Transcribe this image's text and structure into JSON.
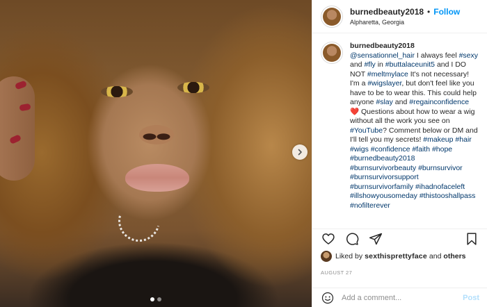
{
  "header": {
    "username": "burnedbeauty2018",
    "separator": "•",
    "follow_label": "Follow",
    "location": "Alpharetta, Georgia"
  },
  "caption": {
    "username": "burnedbeauty2018",
    "segments": [
      {
        "t": "@sensationnel_hair",
        "tag": true
      },
      {
        "t": " I always feel ",
        "tag": false
      },
      {
        "t": "#sexy",
        "tag": true
      },
      {
        "t": " and ",
        "tag": false
      },
      {
        "t": "#fly",
        "tag": true
      },
      {
        "t": " in ",
        "tag": false
      },
      {
        "t": "#buttalaceunit5",
        "tag": true
      },
      {
        "t": " and I DO NOT ",
        "tag": false
      },
      {
        "t": "#meltmylace",
        "tag": true
      },
      {
        "t": " It's not necessary! I'm a ",
        "tag": false
      },
      {
        "t": "#wigslayer",
        "tag": true
      },
      {
        "t": ", but don't feel like you have to be to wear this. This could help anyone ",
        "tag": false
      },
      {
        "t": "#slay",
        "tag": true
      },
      {
        "t": " and ",
        "tag": false
      },
      {
        "t": "#regainconfidence",
        "tag": true
      },
      {
        "t": " ❤️ Questions about how to wear a wig without all the work you see on ",
        "tag": false
      },
      {
        "t": "#YouTube",
        "tag": true
      },
      {
        "t": "? Comment below or DM and I'll tell you my secrets! ",
        "tag": false
      },
      {
        "t": "#makeup",
        "tag": true
      },
      {
        "t": " ",
        "tag": false
      },
      {
        "t": "#hair",
        "tag": true
      },
      {
        "t": " ",
        "tag": false
      },
      {
        "t": "#wigs",
        "tag": true
      },
      {
        "t": " ",
        "tag": false
      },
      {
        "t": "#confidence",
        "tag": true
      },
      {
        "t": " ",
        "tag": false
      },
      {
        "t": "#faith",
        "tag": true
      },
      {
        "t": " ",
        "tag": false
      },
      {
        "t": "#hope",
        "tag": true
      },
      {
        "t": " ",
        "tag": false
      },
      {
        "t": "#burnedbeauty2018",
        "tag": true
      },
      {
        "t": " ",
        "tag": false
      },
      {
        "t": "#burnsurvivorbeauty",
        "tag": true
      },
      {
        "t": " ",
        "tag": false
      },
      {
        "t": "#burnsurvivor",
        "tag": true
      },
      {
        "t": " ",
        "tag": false
      },
      {
        "t": "#burnsurvivorsupport",
        "tag": true
      },
      {
        "t": " ",
        "tag": false
      },
      {
        "t": "#burnsurvivorfamily",
        "tag": true
      },
      {
        "t": " ",
        "tag": false
      },
      {
        "t": "#ihadnofaceleft",
        "tag": true
      },
      {
        "t": " ",
        "tag": false
      },
      {
        "t": "#illshowyousomeday",
        "tag": true
      },
      {
        "t": " ",
        "tag": false
      },
      {
        "t": "#thistooshallpass",
        "tag": true
      },
      {
        "t": " ",
        "tag": false
      },
      {
        "t": "#nofilterever",
        "tag": true
      }
    ]
  },
  "likes": {
    "liked_by": "Liked by",
    "liker": "sexthisprettyface",
    "and_label": "and",
    "others_label": "others"
  },
  "date": "AUGUST 27",
  "comment": {
    "placeholder": "Add a comment...",
    "post_label": "Post"
  },
  "carousel": {
    "slide_count": 2,
    "active_index": 0
  },
  "icons": {
    "like": "heart-icon",
    "comment": "comment-icon",
    "share": "share-icon",
    "save": "bookmark-icon",
    "emoji": "emoji-icon",
    "next": "chevron-right-icon"
  },
  "colors": {
    "follow": "#0095f6",
    "hashtag": "#00376b",
    "post_disabled": "#b2dffc",
    "muted": "#8e8e8e",
    "heart_emoji": "#e0245e"
  }
}
